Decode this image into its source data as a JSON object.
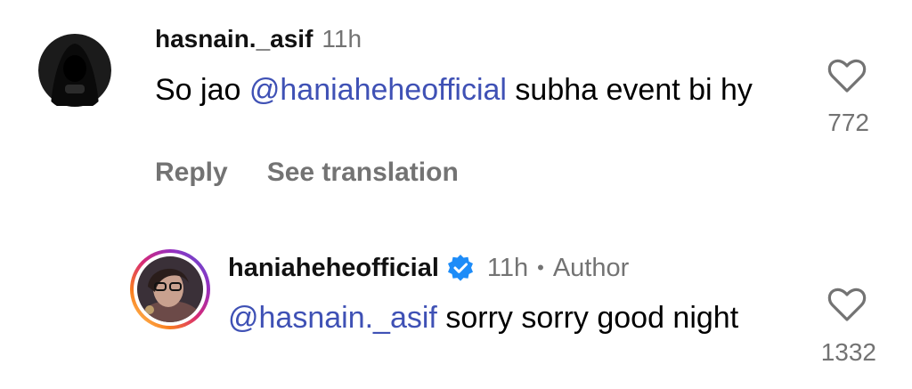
{
  "comments": [
    {
      "username": "hasnain._asif",
      "time": "11h",
      "mention": "@haniaheheofficial",
      "text_before": "So jao ",
      "text_after": " subha event bi hy",
      "actions": {
        "reply": "Reply",
        "translate": "See translation"
      },
      "likes": "772",
      "avatar_icon": "hooded-figure-avatar"
    },
    {
      "username": "haniaheheofficial",
      "verified_icon": "verified-badge-icon",
      "time": "11h",
      "separator": "•",
      "badge": "Author",
      "mention": "@hasnain._asif",
      "text_after": " sorry sorry good night",
      "likes": "1332",
      "avatar_icon": "story-ring-avatar"
    }
  ],
  "colors": {
    "mention": "#3f51b5",
    "meta": "#737373",
    "verified": "#1d8cf8"
  }
}
